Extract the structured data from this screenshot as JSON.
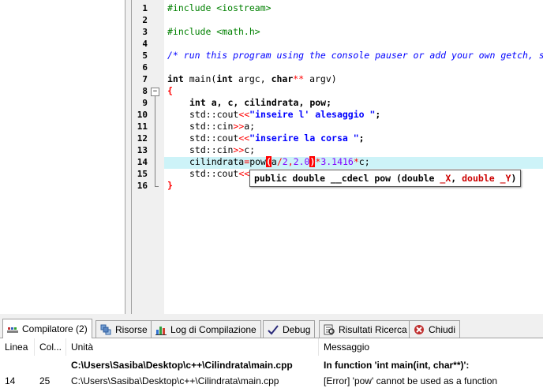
{
  "editor": {
    "line_numbers": [
      "1",
      "2",
      "3",
      "4",
      "5",
      "6",
      "7",
      "8",
      "9",
      "10",
      "11",
      "12",
      "13",
      "14",
      "15",
      "16"
    ],
    "lines": {
      "l1": "#include <iostream>",
      "l3": "#include <math.h>",
      "l5": "/* run this program using the console pauser or add your own getch, system(\"pause\") or input loop */",
      "l7_kw1": "int",
      "l7_a": " main(",
      "l7_kw2": "int",
      "l7_b": " argc, ",
      "l7_kw3": "char",
      "l7_op": "**",
      "l7_c": " argv)",
      "l8": "{",
      "l9_kw": "int",
      "l9_rest": " a, c, cilindrata, pow;",
      "l10_a": "std::cout",
      "l10_op": "<<",
      "l10_str": "\"inseire l' alesaggio \"",
      "l10_end": ";",
      "l11_a": "std::cin",
      "l11_op": ">>",
      "l11_b": "a;",
      "l12_a": "std::cout",
      "l12_op": "<<",
      "l12_str": "\"inserire la corsa \"",
      "l12_end": ";",
      "l13_a": "std::cin",
      "l13_op": ">>",
      "l13_b": "c;",
      "l14_a": "cilindrata",
      "l14_eq": "=",
      "l14_b": "pow",
      "l14_p1": "(",
      "l14_c": "a",
      "l14_d": "/",
      "l14_n1": "2",
      "l14_e": ",",
      "l14_n2": "2.0",
      "l14_p2": ")",
      "l14_f": "*",
      "l14_n3": "3.1416",
      "l14_g": "*",
      "l14_h": "c;",
      "l15_a": "std::cout",
      "l15_op": "<<",
      "l16": "}"
    },
    "tooltip": {
      "prefix": "public double __cdecl pow (double ",
      "p1": "_X",
      "mid": ", ",
      "p2": "double _Y",
      "suffix": ")"
    }
  },
  "tabs": [
    {
      "label": "Compilatore (2)",
      "icon": "compiler-icon"
    },
    {
      "label": "Risorse",
      "icon": "resources-icon"
    },
    {
      "label": "Log di Compilazione",
      "icon": "chart-icon"
    },
    {
      "label": "Debug",
      "icon": "check-icon"
    },
    {
      "label": "Risultati Ricerca",
      "icon": "search-results-icon"
    },
    {
      "label": "Chiudi",
      "icon": "close-icon"
    }
  ],
  "table": {
    "headers": [
      "Linea",
      "Col...",
      "Unità",
      "Messaggio"
    ],
    "rows": [
      {
        "line": "",
        "col": "",
        "unit": "C:\\Users\\Sasiba\\Desktop\\c++\\Cilindrata\\main.cpp",
        "message": "In function 'int main(int, char**)':",
        "bold": true
      },
      {
        "line": "14",
        "col": "25",
        "unit": "C:\\Users\\Sasiba\\Desktop\\c++\\Cilindrata\\main.cpp",
        "message": "[Error] 'pow' cannot be used as a function",
        "bold": false
      }
    ]
  },
  "colors": {
    "highlight_line": "#cdf3f8",
    "keyword_op": "#ff0000",
    "string": "#0000ff",
    "number": "#8000ff",
    "comment": "#0000ff",
    "preprocessor": "#008000"
  }
}
